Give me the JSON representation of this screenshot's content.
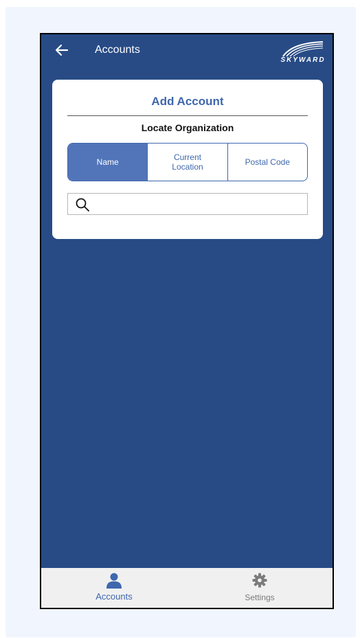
{
  "header": {
    "title": "Accounts",
    "logo_text": "SKYWARD"
  },
  "card": {
    "title": "Add Account",
    "subtitle": "Locate Organization",
    "segments": [
      {
        "label_line1": "Name",
        "label_line2": "",
        "active": true
      },
      {
        "label_line1": "Current",
        "label_line2": "Location",
        "active": false
      },
      {
        "label_line1": "Postal Code",
        "label_line2": "",
        "active": false
      }
    ],
    "search": {
      "value": "",
      "placeholder": ""
    }
  },
  "tabbar": {
    "items": [
      {
        "label": "Accounts",
        "icon": "person-icon",
        "active": true
      },
      {
        "label": "Settings",
        "icon": "gear-icon",
        "active": false
      }
    ]
  },
  "colors": {
    "background": "#284b86",
    "accent": "#3f67ad",
    "active_segment": "#5275b9",
    "tabbar": "#f0f0f0"
  }
}
